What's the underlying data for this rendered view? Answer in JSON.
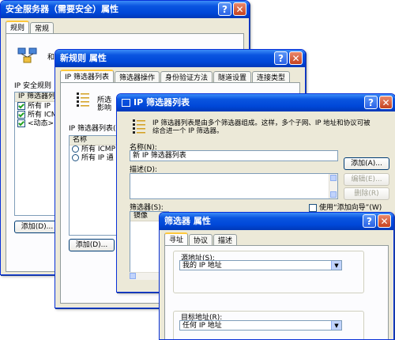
{
  "win1": {
    "title": "安全服务器（需要安全）属性",
    "tabs": [
      "规则",
      "常规"
    ],
    "intro_fragment": "和",
    "list_label": "IP 安全规则",
    "list_header": "IP 筛选器列",
    "rows": [
      {
        "checked": true,
        "text": "所有 IP"
      },
      {
        "checked": true,
        "text": "所有 ICM"
      },
      {
        "checked": true,
        "text": "<动态>"
      }
    ],
    "add_button": "添加(D)..."
  },
  "win2": {
    "title": "新规则 属性",
    "tabs": [
      "IP 筛选器列表",
      "筛选器操作",
      "身份验证方法",
      "隧道设置",
      "连接类型"
    ],
    "desc_line1": "所选",
    "desc_line2": "影响",
    "list_label": "IP 筛选器列表(",
    "list_header": "名称",
    "rows": [
      "所有 ICMP 通",
      "所有 IP 通"
    ],
    "add_button": "添加(D)..."
  },
  "win3": {
    "title": "IP 筛选器列表",
    "desc_line1": "IP 筛选器列表是由多个筛选器组成。这样，多个子网、IP 地址和协议可被",
    "desc_line2": "综合进一个 IP 筛选器。",
    "name_label": "名称(N):",
    "name_value": "新 IP 筛选器列表",
    "desc_label": "描述(D):",
    "add_button": "添加(A)...",
    "edit_button": "编辑(E)...",
    "remove_button": "删除(R)",
    "filters_label": "筛选器(S):",
    "wizard_checkbox": "使用“添加向导”(W)",
    "filters_header": "镜像"
  },
  "win4": {
    "title": "筛选器 属性",
    "tabs": [
      "寻址",
      "协议",
      "描述"
    ],
    "source_label": "源地址(S):",
    "source_value": "我的 IP 地址",
    "dest_label": "目标地址(R):",
    "dest_value": "任何 IP 地址"
  }
}
